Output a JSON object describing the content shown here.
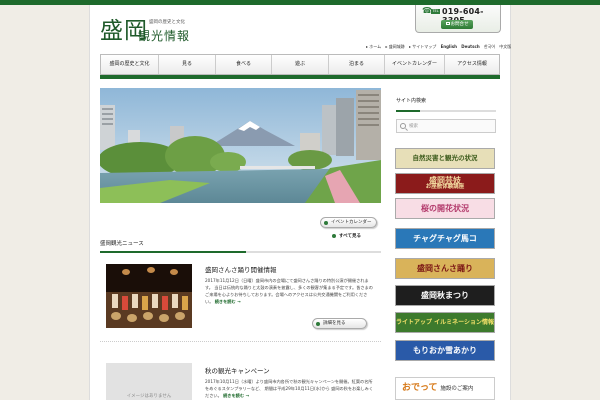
{
  "header": {
    "logo_main": "盛岡",
    "logo_sub": "観光情報",
    "tagline": "盛岡の歴史と文化",
    "phone_badge": "TEL",
    "phone_number": "019-604-3305",
    "contact_label": "お問合せ"
  },
  "util_links": [
    "▸ ホーム",
    "▸ 盛岡城跡",
    "▸ サイトマップ",
    "English",
    "Deutsch",
    "한국어",
    "中文版"
  ],
  "nav": [
    {
      "label": "盛岡の歴史と文化",
      "width": 58
    },
    {
      "label": "見る",
      "width": 57
    },
    {
      "label": "食べる",
      "width": 56
    },
    {
      "label": "遊ぶ",
      "width": 57
    },
    {
      "label": "泊まる",
      "width": 56
    },
    {
      "label": "イベントカレンダー",
      "width": 60
    },
    {
      "label": "アクセス情報",
      "width": 56
    }
  ],
  "main": {
    "event_calendar_button": "イベントカレンダー",
    "see_all": "すべて見る",
    "section_title": "盛岡観光ニュース",
    "posts": [
      {
        "title": "盛岡さんさ踊り開催情報",
        "excerpt": "2017年11月12日（日曜）盛岡市内の会場にて盛岡さんさ踊りの特別公演が開催されます。 当日は伝統的な踊りと太鼓の演奏を披露し、多くの観客が集まる予定です。皆さまのご来場を心よりお待ちしております。会場へのアクセスは公共交通機関をご利用ください。",
        "more": "続きを読む →",
        "details_button": "詳細を見る"
      },
      {
        "title": "秋の観光キャンペーン",
        "excerpt": "2017年10月11日（水曜）より盛岡市内各所で秋の観光キャンペーンを開催。紅葉の名所をめぐるスタンプラリーなど、 期間は平成29年10月11日(水)から 盛岡の秋をお楽しみください。",
        "more": "続きを読む →",
        "no_image": "イメージはありません"
      }
    ]
  },
  "sidebar": {
    "search_title": "サイト内検索",
    "search_placeholder": "検索",
    "banners": [
      {
        "label": "自然災害と観光の状況",
        "bg": "#e7dfb8",
        "color": "#3b5a1a"
      },
      {
        "label": "盛岡芸妓",
        "sub": "お座敷体験講座",
        "bg": "#8b1b1b",
        "color": "#f3dba0"
      },
      {
        "label": "桜の開花状況",
        "bg": "#f8dde5",
        "color": "#b2386a"
      },
      {
        "label": "チャグチャグ馬コ",
        "bg": "#2a78b8",
        "color": "#ffffff"
      },
      {
        "label": "盛岡さんさ踊り",
        "bg": "#d9b35a",
        "color": "#7a1414"
      },
      {
        "label": "盛岡秋まつり",
        "bg": "#1e1e1e",
        "color": "#ffffff"
      },
      {
        "label": "ライトアップ イルミネーション情報",
        "bg": "#3d7a2d",
        "color": "#f5e26a"
      },
      {
        "label": "もりおか雪あかり",
        "bg": "#2a5aa8",
        "color": "#ffffff"
      },
      {
        "label": "おでって",
        "sub": "施設のご案内",
        "bg": "#ffffff",
        "color": "#2e7a3a"
      }
    ]
  }
}
